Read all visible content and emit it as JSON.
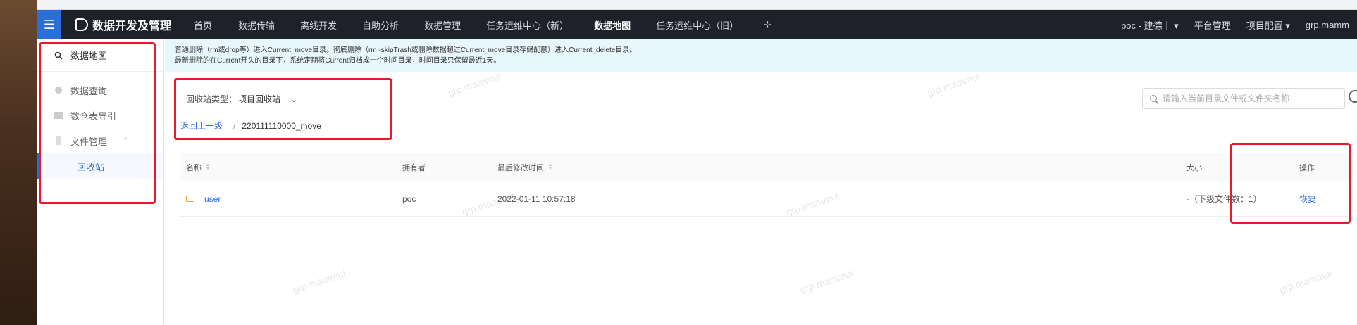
{
  "app": {
    "title": "数据开发及管理"
  },
  "topnav": {
    "items": [
      "首页",
      "数据传输",
      "离线开发",
      "自助分析",
      "数据管理",
      "任务运维中心（新）",
      "数据地图",
      "任务运维中心（旧）"
    ],
    "active_index": 6,
    "right": [
      "poc - 建德十 ▾",
      "平台管理",
      "项目配置 ▾",
      "grp.mamm"
    ]
  },
  "sidebar": {
    "items": [
      {
        "label": "数据地图",
        "icon": "search-icon"
      },
      {
        "label": "数据查询",
        "icon": "query-icon"
      },
      {
        "label": "数仓表导引",
        "icon": "table-icon"
      },
      {
        "label": "文件管理",
        "icon": "file-icon"
      },
      {
        "label": "回收站",
        "icon": ""
      }
    ]
  },
  "notice": {
    "line1": "普通删除（rm或drop等）进入Current_move目录。彻底删除（rm -skipTrash或删除数据超过Current_move目录存储配额）进入Current_delete目录。",
    "line2": "最新删除的在Current开头的目录下，系统定期将Current归档成一个时间目录，时间目录只保留最近1天。"
  },
  "recycle": {
    "type_label": "回收站类型：",
    "type_value": "项目回收站",
    "back_link": "返回上一级",
    "current_path": "220111110000_move"
  },
  "search": {
    "placeholder": "请输入当前目录文件或文件夹名称"
  },
  "table": {
    "headers": {
      "name": "名称",
      "owner": "拥有者",
      "modified": "最后修改时间",
      "size": "大小",
      "action": "操作"
    },
    "rows": [
      {
        "name": "user",
        "owner": "poc",
        "modified": "2022-01-11 10:57:18",
        "size": "-（下级文件数：1）",
        "action": "恢复"
      }
    ]
  },
  "watermark": "grp.mammut",
  "colors": {
    "accent": "#2d6ae0",
    "nav_bg": "#1e2129",
    "highlight_box": "#e8192c",
    "notice_bg": "#e8f6fd"
  }
}
